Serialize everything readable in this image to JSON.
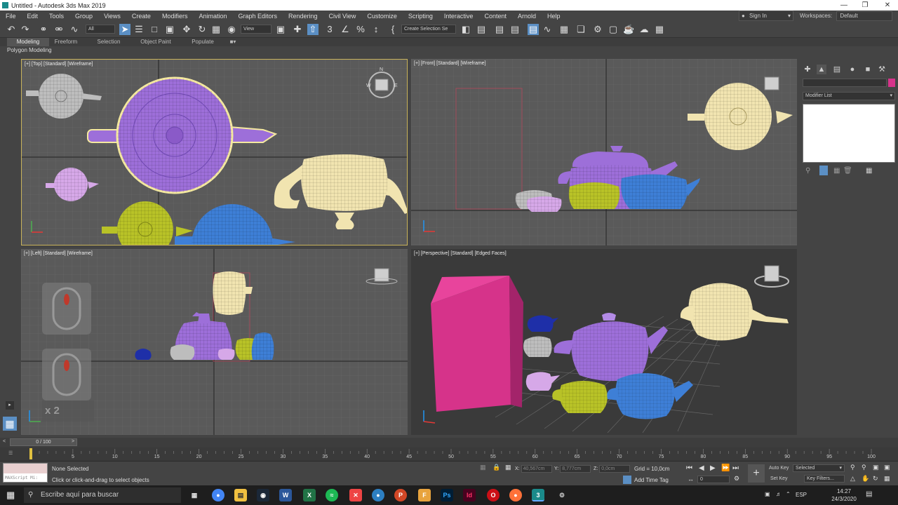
{
  "window": {
    "title": "Untitled - Autodesk 3ds Max 2019",
    "controls": [
      "—",
      "❐",
      "✕"
    ]
  },
  "menubar": {
    "items": [
      "File",
      "Edit",
      "Tools",
      "Group",
      "Views",
      "Create",
      "Modifiers",
      "Animation",
      "Graph Editors",
      "Rendering",
      "Civil View",
      "Customize",
      "Scripting",
      "Interactive",
      "Content",
      "Arnold",
      "Help"
    ],
    "signin": "Sign In",
    "workspaces_label": "Workspaces:",
    "workspaces_value": "Default"
  },
  "toolbar": {
    "filter_value": "All",
    "refcoord_value": "View",
    "selection_set_placeholder": "Create Selection Se"
  },
  "ribbon": {
    "tabs": [
      "Modeling",
      "Freeform",
      "Selection",
      "Object Paint",
      "Populate"
    ],
    "active_tab": "Modeling",
    "sub_label": "Polygon Modeling"
  },
  "viewports": {
    "top": "[+] [Top] [Standard] [Wireframe]",
    "front": "[+] [Front] [Standard] [Wireframe]",
    "left": "[+] [Left] [Standard] [Wireframe]",
    "perspective": "[+] [Perspective] [Standard] [Edged Faces]",
    "left_overlay": "x 2"
  },
  "command_panel": {
    "modifier_list": "Modifier List"
  },
  "timeline": {
    "frame_display": "0 / 100",
    "current_frame": 0,
    "total_frames": 100,
    "ticks": [
      "5",
      "10",
      "15",
      "20",
      "25",
      "30",
      "35",
      "40",
      "45",
      "50",
      "55",
      "60",
      "65",
      "70",
      "75",
      "80",
      "85",
      "90",
      "95",
      "100"
    ]
  },
  "status": {
    "maxscript": "MAXScript Mi:",
    "selection": "None Selected",
    "prompt": "Click or click-and-drag to select objects",
    "x_label": "X:",
    "x_value": "40,567cm",
    "y_label": "Y:",
    "y_value": "8,777cm",
    "z_label": "Z:",
    "z_value": "0,0cm",
    "grid": "Grid = 10,0cm",
    "add_time_tag": "Add Time Tag",
    "auto_key": "Auto Key",
    "set_key": "Set Key",
    "selected_dd": "Selected",
    "key_filters": "Key Filters...",
    "frame_field": "0"
  },
  "taskbar": {
    "search_placeholder": "Escribe aquí para buscar",
    "lang": "ESP",
    "time": "14:27",
    "date": "24/3/2020"
  },
  "colors": {
    "accent_blue": "#5b8fc4",
    "selection_yellow": "#c8b25a",
    "box_magenta": "#d6338a",
    "teapot_purple": "#9d6fd9",
    "teapot_yellow": "#b8c227",
    "teapot_blue": "#3e7fd6",
    "teapot_cream": "#f1e4b0",
    "teapot_lilac": "#d6a8e8",
    "teapot_grey": "#bdbdbd",
    "teapot_navy": "#1e2fa8"
  }
}
